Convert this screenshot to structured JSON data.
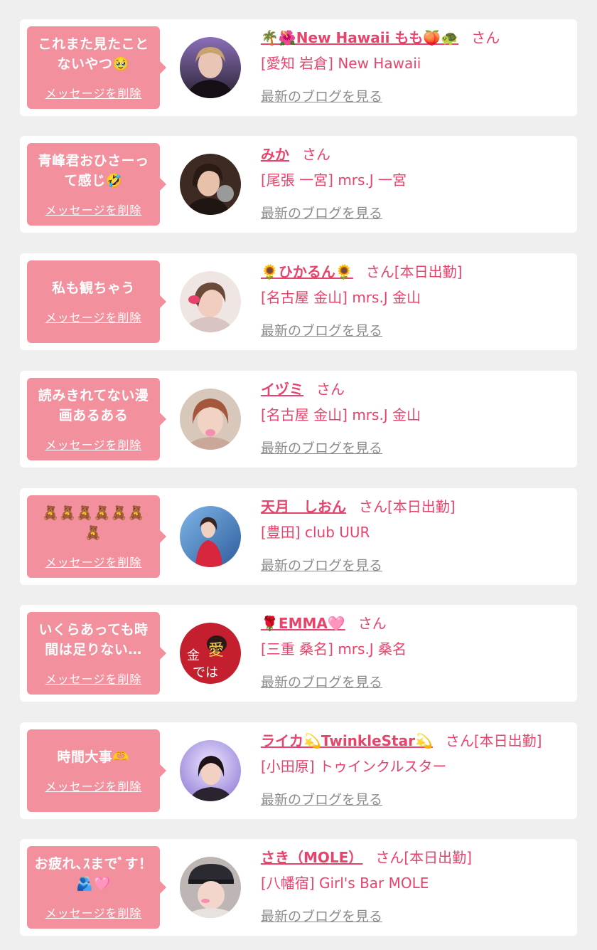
{
  "colors": {
    "accent": "#e8436b",
    "bubble": "#f3909d",
    "link": "#8c8c8c",
    "background": "#efefef"
  },
  "common": {
    "delete_label": "メッセージを削除",
    "blog_label": "最新のブログを見る"
  },
  "cards": [
    {
      "message": "これまた見たこと\nないやつ🥹",
      "name": "🌴🌺New Hawaii もも🍑🐢",
      "honorific": "さん",
      "shop": "[愛知 岩倉] New Hawaii"
    },
    {
      "message": "青峰君おひさーっ\nて感じ🤣",
      "name": "みか",
      "honorific": "さん",
      "shop": "[尾張 一宮] mrs.J 一宮"
    },
    {
      "message": "私も観ちゃう",
      "name": "🌻ひかるん🌻",
      "honorific": "さん[本日出勤]",
      "shop": "[名古屋 金山] mrs.J 金山"
    },
    {
      "message": "読みきれてない漫\n画あるある",
      "name": "イヅミ",
      "honorific": "さん",
      "shop": "[名古屋 金山] mrs.J 金山"
    },
    {
      "message": "🧸🧸🧸🧸🧸🧸\n🧸",
      "name": "天月　しおん",
      "honorific": "さん[本日出勤]",
      "shop": "[豊田] club UUR"
    },
    {
      "message": "いくらあっても時\n間は足りない…",
      "name": "🌹EMMA🩷",
      "honorific": "さん",
      "shop": "[三重 桑名] mrs.J 桑名"
    },
    {
      "message": "時間大事🫶",
      "name": "ライカ💫TwinkleStar💫",
      "honorific": "さん[本日出勤]",
      "shop": "[小田原] トゥインクルスター"
    },
    {
      "message": "お疲れ､ｽまでﾞす！\n🫂🩷",
      "name": "さき（MOLE）",
      "honorific": "さん[本日出勤]",
      "shop": "[八幡宿] Girl's Bar MOLE"
    }
  ]
}
